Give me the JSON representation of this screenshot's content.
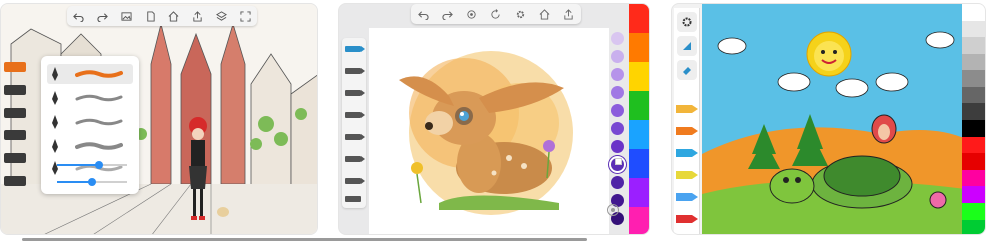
{
  "screenshots": [
    {
      "toolbar": [
        "undo-icon",
        "redo-icon",
        "image-icon",
        "page-icon",
        "home-icon",
        "share-icon",
        "layers-icon",
        "fullscreen-icon"
      ],
      "brush_popup": {
        "brushes": [
          "pen",
          "marker",
          "pencil",
          "airbrush",
          "crayon"
        ],
        "selected_brush_index": 0,
        "size_slider_value": 0.6,
        "opacity_slider_value": 0.5
      },
      "accent_color": "#e8701a"
    },
    {
      "toolbar": [
        "undo-icon",
        "redo-icon",
        "settings-icon",
        "rotate-icon",
        "gear-icon",
        "home-icon",
        "share-icon"
      ],
      "swatches": [
        "#d9c6f0",
        "#c9b0ee",
        "#b693ea",
        "#a078e4",
        "#8b5cdc",
        "#7848d2",
        "#6a34c8",
        "#5b2fb5",
        "#4f24a6",
        "#42188f",
        "#341078"
      ],
      "selected_swatch_index": 7,
      "palette_strip": [
        "#ff2a1a",
        "#ff7a00",
        "#ffd400",
        "#1fbf1f",
        "#1aa3ff",
        "#1f4dff",
        "#9b1fff",
        "#ff1fb0"
      ]
    },
    {
      "tools": [
        "settings-icon",
        "bucket-icon",
        "eraser-icon"
      ],
      "crayons": [
        "#f2b53a",
        "#f07b1f",
        "#2fa7e0",
        "#e7d83a",
        "#4aa3f0",
        "#e03030"
      ],
      "palette_strip": [
        "#ffffff",
        "#e6e6e6",
        "#cfcfcf",
        "#b3b3b3",
        "#8c8c8c",
        "#666666",
        "#3d3d3d",
        "#000000",
        "#ff1a1a",
        "#e60000",
        "#ff00a0",
        "#cc00ff",
        "#1aff1a",
        "#00cc33"
      ],
      "sky_color": "#5ac0e6"
    }
  ]
}
